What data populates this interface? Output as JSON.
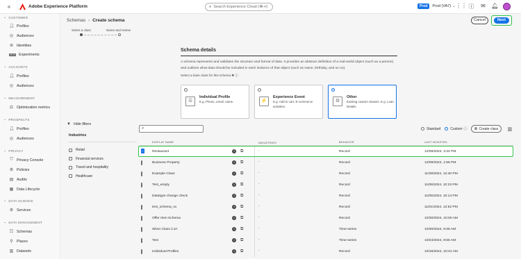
{
  "topbar": {
    "app_title": "Adobe Experience Platform",
    "search_placeholder": "Search Experience Cloud (⌘+/)",
    "env_badge": "Prod",
    "env_name": "Prod (VA7)"
  },
  "sidebar": {
    "sections": [
      {
        "title": "CUSTOMER",
        "items": [
          "Profiles",
          "Audiences",
          "Identities",
          "Experiments"
        ]
      },
      {
        "title": "ACCOUNTS",
        "items": [
          "Profiles",
          "Audiences"
        ]
      },
      {
        "title": "MEASUREMENT",
        "items": [
          "Optimization metrics"
        ]
      },
      {
        "title": "PROSPECTS",
        "items": [
          "Profiles",
          "Audiences"
        ]
      },
      {
        "title": "PRIVACY",
        "items": [
          "Privacy Console",
          "Policies",
          "Audits",
          "Data Lifecycle"
        ]
      },
      {
        "title": "DATA SCIENCE",
        "items": [
          "Services"
        ]
      },
      {
        "title": "DATA MANAGEMENT",
        "items": [
          "Schemas",
          "Places",
          "Datasets"
        ]
      }
    ],
    "experiments_tag": "NEW"
  },
  "header": {
    "breadcrumb_root": "Schemas",
    "breadcrumb_current": "Create schema",
    "cancel_label": "Cancel",
    "next_label": "Next",
    "step1": "Select a class",
    "step2": "Name and review"
  },
  "details": {
    "title": "Schema details",
    "description": "A schema represents and validates the structure and format of data. It provides an abstract definition of a real-world object (such as a person) and outlines what data should be included in each instance of that object (such as name, birthday, and so on).",
    "select_label": "Select a base class for this schema ✱ ⓘ",
    "cards": [
      {
        "title": "Individual Profile",
        "subtitle": "E.g. Phone, email, name.",
        "selected": false
      },
      {
        "title": "Experience Event",
        "subtitle": "E.g. Add to cart, E-commerce activities.",
        "selected": false
      },
      {
        "title": "Other",
        "subtitle": "Existing custom classes. E.g. Loan Details.",
        "selected": true
      }
    ]
  },
  "filters": {
    "hide_label": "Hide filters",
    "industries_title": "Industries",
    "industries": [
      "Retail",
      "Financial services",
      "Travel and hospitality",
      "Healthcare"
    ]
  },
  "table_tools": {
    "standard_label": "Standard",
    "custom_label": "Custom",
    "create_class_label": "Create class"
  },
  "table": {
    "headers": [
      "DISPLAY NAME",
      "INDUSTRIES",
      "BEHAVIOR",
      "LAST MODIFIED"
    ],
    "rows": [
      {
        "name": "Restaurant",
        "industries": "-",
        "behavior": "Record",
        "modified": "12/09/2024, 3:32 PM",
        "selected": true
      },
      {
        "name": "Business Property",
        "industries": "-",
        "behavior": "Record",
        "modified": "12/09/2024, 1:55 PM",
        "selected": false
      },
      {
        "name": "Example Class",
        "industries": "-",
        "behavior": "Record",
        "modified": "11/28/2024, 12:40 PM",
        "selected": false
      },
      {
        "name": "Test_empty",
        "industries": "-",
        "behavior": "Record",
        "modified": "11/06/2024, 10:23 PM",
        "selected": false
      },
      {
        "name": "Datatype change check",
        "industries": "-",
        "behavior": "Record",
        "modified": "11/05/2024, 10:14 PM",
        "selected": false
      },
      {
        "name": "test_schema_ra",
        "industries": "-",
        "behavior": "Record",
        "modified": "11/01/2024, 12:52 PM",
        "selected": false
      },
      {
        "name": "Offer Item Schema",
        "industries": "-",
        "behavior": "Record",
        "modified": "10/30/2024, 10:00 AM",
        "selected": false
      },
      {
        "name": "Silver Class CJA",
        "industries": "-",
        "behavior": "Time-series",
        "modified": "10/30/2024, 9:35 AM",
        "selected": false
      },
      {
        "name": "Test",
        "industries": "-",
        "behavior": "Time-series",
        "modified": "10/24/2024, 9:55 AM",
        "selected": false
      },
      {
        "name": "Individual Profiles",
        "industries": "-",
        "behavior": "Record",
        "modified": "10/18/2024, 10:31 AM",
        "selected": false
      }
    ]
  }
}
